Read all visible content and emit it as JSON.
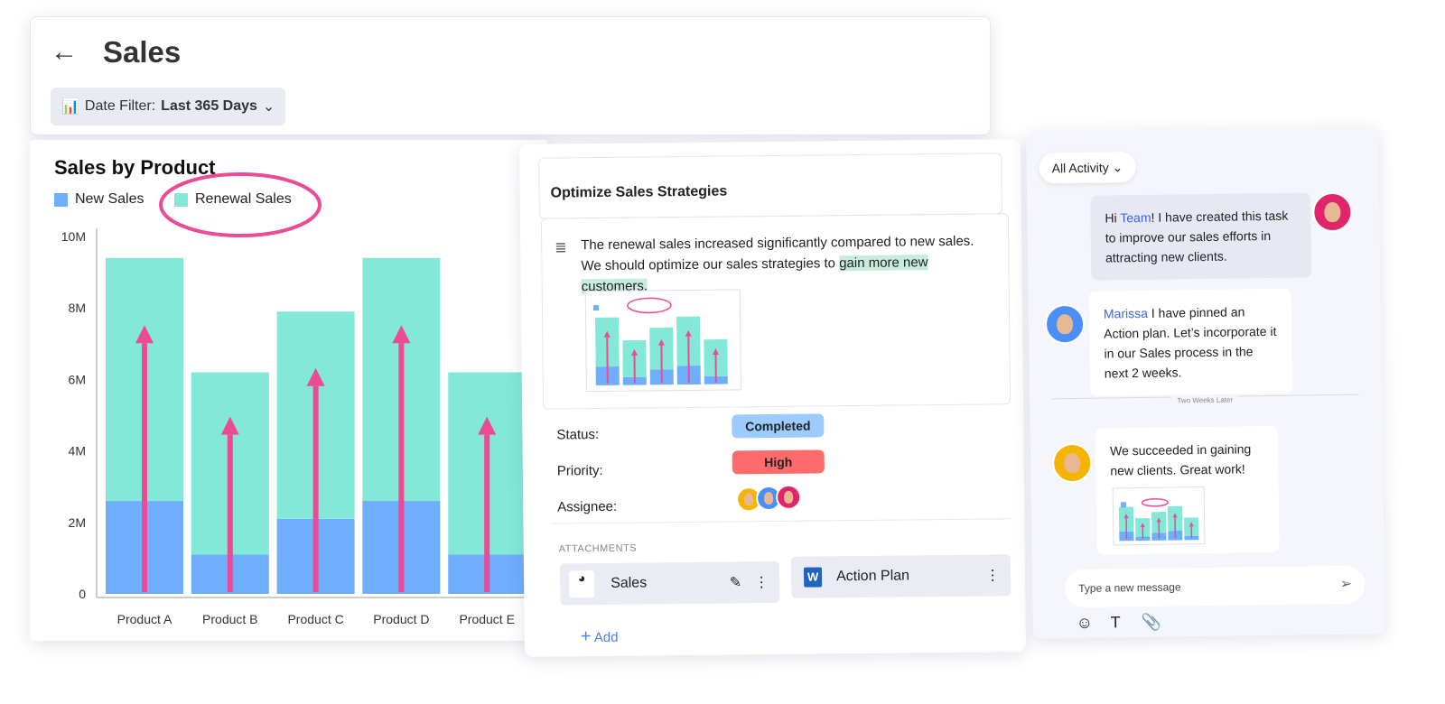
{
  "header": {
    "title": "Sales",
    "back_icon": "arrow-left-icon",
    "date_filter_label": "Date Filter:",
    "date_filter_value": "Last 365 Days"
  },
  "chart_data": {
    "type": "bar",
    "stacked": true,
    "title": "Sales by Product",
    "categories": [
      "Product A",
      "Product B",
      "Product C",
      "Product D",
      "Product E"
    ],
    "series": [
      {
        "name": "New Sales",
        "values": [
          2.6,
          1.1,
          2.1,
          2.6,
          1.1
        ],
        "color": "#6eaefc"
      },
      {
        "name": "Renewal Sales",
        "values": [
          6.8,
          5.1,
          5.8,
          6.8,
          5.1
        ],
        "color": "#84e8d8"
      }
    ],
    "yticks": [
      "0",
      "2M",
      "4M",
      "6M",
      "8M",
      "10M"
    ],
    "ylim": [
      0,
      10
    ],
    "unit": "M",
    "annotation_color": "#ec4a94",
    "legend": "top-left"
  },
  "task": {
    "title": "Optimize Sales Strategies",
    "description": "The renewal sales increased significantly compared to new sales. We should optimize our sales strategies to ",
    "description_highlight": "gain more new customers.",
    "status_label": "Status:",
    "status": "Completed",
    "status_color": "#9ccbff",
    "priority_label": "Priority:",
    "priority": "High",
    "priority_color": "#fe6b6b",
    "assignee_label": "Assignee:",
    "attachments_label": "ATTACHMENTS",
    "attachments": [
      {
        "name": "Sales"
      },
      {
        "name": "Action Plan",
        "icon": "W"
      }
    ],
    "add_label": "Add"
  },
  "chat": {
    "filter": "All Activity",
    "messages": [
      {
        "mention": "Team",
        "text": "! I have created this task to improve our sales efforts in attracting new clients."
      },
      {
        "mention": "Marissa",
        "text": " I have pinned an Action plan. Let’s incorporate it in our Sales process in the next 2 weeks."
      },
      {
        "text": "We succeeded in gaining new clients. Great work!"
      }
    ],
    "separator": "Two Weeks Later",
    "input_placeholder": "Type a new message"
  }
}
